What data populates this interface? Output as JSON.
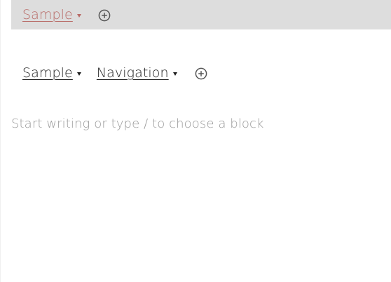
{
  "top_nav": {
    "items": [
      {
        "label": "Sample",
        "has_dropdown": true
      }
    ],
    "add_icon": "plus-circle-icon"
  },
  "main_nav": {
    "items": [
      {
        "label": "Sample",
        "has_dropdown": true
      },
      {
        "label": "Navigation",
        "has_dropdown": true
      }
    ],
    "add_icon": "plus-circle-icon"
  },
  "editor": {
    "placeholder": "Start writing or type / to choose a block"
  },
  "colors": {
    "highlight_bar": "#dddddd",
    "highlight_text": "#b86a66",
    "text": "#1e1e1e",
    "placeholder": "#9a9a9a"
  }
}
